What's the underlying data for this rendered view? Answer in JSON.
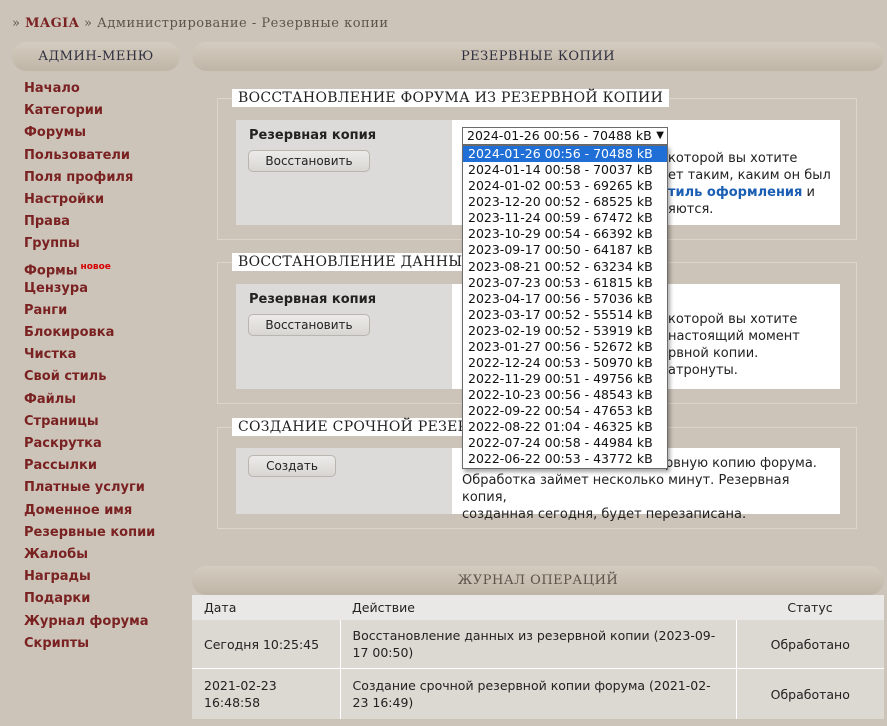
{
  "breadcrumb": {
    "prefix": "» ",
    "brand": "MAGIA",
    "rest": " » Администрирование - Резервные копии"
  },
  "sidebar": {
    "title": "АДМИН-МЕНЮ",
    "items": [
      {
        "label": "Начало"
      },
      {
        "label": "Категории"
      },
      {
        "label": "Форумы"
      },
      {
        "label": "Пользователи"
      },
      {
        "label": "Поля профиля"
      },
      {
        "label": "Настройки"
      },
      {
        "label": "Права"
      },
      {
        "label": "Группы"
      },
      {
        "label": "Формы",
        "badge": "новое"
      },
      {
        "label": "Цензура"
      },
      {
        "label": "Ранги"
      },
      {
        "label": "Блокировка"
      },
      {
        "label": "Чистка"
      },
      {
        "label": "Свой стиль"
      },
      {
        "label": "Файлы"
      },
      {
        "label": "Страницы"
      },
      {
        "label": "Раскрутка"
      },
      {
        "label": "Рассылки"
      },
      {
        "label": "Платные услуги"
      },
      {
        "label": "Доменное имя"
      },
      {
        "label": "Резервные копии"
      },
      {
        "label": "Жалобы"
      },
      {
        "label": "Награды"
      },
      {
        "label": "Подарки"
      },
      {
        "label": "Журнал форума"
      },
      {
        "label": "Скрипты"
      }
    ]
  },
  "main": {
    "title": "РЕЗЕРВНЫЕ КОПИИ"
  },
  "restore_forum": {
    "legend": "ВОССТАНОВЛЕНИЕ ФОРУМА ИЗ РЕЗЕРВНОЙ КОПИИ",
    "label": "Резервная копия",
    "button": "Восстановить",
    "desc_line1": "которой вы хотите",
    "desc_line2": "ет таким, каким он был",
    "desc_bold": "тиль оформления",
    "desc_after": " и",
    "desc_line4": "яются."
  },
  "restore_data": {
    "legend": "ВОССТАНОВЛЕНИЕ ДАННЫХ И",
    "label": "Резервная копия",
    "button": "Восстановить",
    "desc_line1": "которой вы хотите",
    "desc_line2": "настоящий момент",
    "desc_line3": "рвной копии.",
    "desc_line4": "атронуты."
  },
  "create_backup": {
    "legend": "СОЗДАНИЕ СРОЧНОЙ РЕЗЕРВ",
    "button": "Создать",
    "desc_line1": "рвную копию форума.",
    "desc_line2": "Обработка займет несколько минут. Резервная копия,",
    "desc_line3": "созданная сегодня, будет перезаписана."
  },
  "select": {
    "selected": "2024-01-26 00:56 - 70488 kB",
    "options": [
      "2024-01-26 00:56 - 70488 kB",
      "2024-01-14 00:58 - 70037 kB",
      "2024-01-02 00:53 - 69265 kB",
      "2023-12-20 00:52 - 68525 kB",
      "2023-11-24 00:59 - 67472 kB",
      "2023-10-29 00:54 - 66392 kB",
      "2023-09-17 00:50 - 64187 kB",
      "2023-08-21 00:52 - 63234 kB",
      "2023-07-23 00:53 - 61815 kB",
      "2023-04-17 00:56 - 57036 kB",
      "2023-03-17 00:52 - 55514 kB",
      "2023-02-19 00:52 - 53919 kB",
      "2023-01-27 00:56 - 52672 kB",
      "2022-12-24 00:53 - 50970 kB",
      "2022-11-29 00:51 - 49756 kB",
      "2022-10-23 00:56 - 48543 kB",
      "2022-09-22 00:54 - 47653 kB",
      "2022-08-22 01:04 - 46325 kB",
      "2022-07-24 00:58 - 44984 kB",
      "2022-06-22 00:53 - 43772 kB"
    ]
  },
  "log": {
    "title": "ЖУРНАЛ ОПЕРАЦИЙ",
    "columns": {
      "date": "Дата",
      "action": "Действие",
      "status": "Статус"
    },
    "rows": [
      {
        "date": "Сегодня 10:25:45",
        "action": "Восстановление данных из резервной копии (2023-09-17 00:50)",
        "status": "Обработано"
      },
      {
        "date": "2021-02-23 16:48:58",
        "action": "Создание срочной резервной копии форума (2021-02-23 16:49)",
        "status": "Обработано"
      }
    ]
  }
}
